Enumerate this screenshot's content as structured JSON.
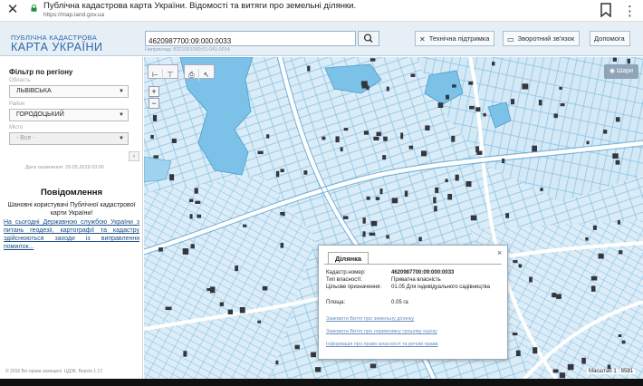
{
  "browser": {
    "page_title": "Публічна кадастрова карта України. Відомості та витяги про земельні ділянки.",
    "url": "https://map.land.gov.ua"
  },
  "header": {
    "logo_line1": "ПУБЛІЧНА КАДАСТРОВА",
    "logo_line2": "КАРТА УКРАЇНИ",
    "search_value": "4620987700:09:000:0033",
    "search_hint": "Наприклад: 8221001000:01:041:0014",
    "support_label": "Технічна підтримка",
    "feedback_label": "Зворотний зв'язок",
    "help_label": "Допомога"
  },
  "sidebar": {
    "filter_title": "Фільтр по регіону",
    "oblast_label": "Область",
    "oblast_value": "ЛЬВІВСЬКА",
    "rayon_label": "Район",
    "rayon_value": "ГОРОДОЦЬКИЙ",
    "misto_label": "Місто",
    "misto_value": "- Все -",
    "update_date": "Дата оновлення: 29.05.2019 03:00",
    "notif_title": "Повідомлення",
    "notif_greeting": "Шановні користувачі Публічної кадастрової карти України!",
    "notif_body": "На сьогодні Державною службою України з питань геодезії, картографії та кадастру здійснюються заходи із виправлення помилок...",
    "copyright": "© 2016 Всі права захищені. ЦДЗК. Версія 1.17."
  },
  "map": {
    "layers_label": "Шари",
    "scale_text": "Масштаб 1 : 8531"
  },
  "popup": {
    "tab_label": "Ділянка",
    "rows": [
      {
        "label": "Кадастр.номер:",
        "value": "4620987700:09:000:0033"
      },
      {
        "label": "Тип власності:",
        "value": "Приватна власність"
      },
      {
        "label": "Цільове призначення:",
        "value": "01.05 Для індивідуального садівництва"
      },
      {
        "label": "Площа:",
        "value": "0.05 га"
      }
    ],
    "link1": "Замовити Витяг про земельну ділянку",
    "link2": "Замовити Витяг про нормативну грошову оцінку",
    "link3": "Інформація про право власності та речові права"
  },
  "colors": {
    "water": "#7cc2e8",
    "parcel_stroke": "#7fb8dc",
    "parcel_fill": "#d6eaf6",
    "roads": "#ffffff",
    "buildings": "#33373d"
  }
}
